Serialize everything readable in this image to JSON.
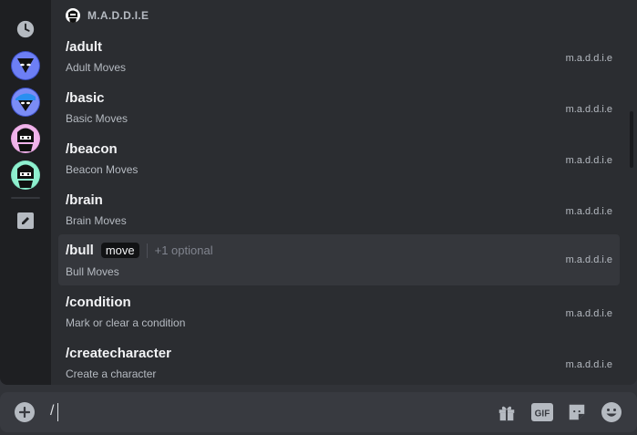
{
  "app_section": {
    "name": "M.A.D.D.I.E"
  },
  "rail": {
    "items": [
      {
        "id": "recent",
        "icon": "clock-icon"
      },
      {
        "id": "bot-1",
        "icon": "bot-avatar-blue"
      },
      {
        "id": "bot-2",
        "icon": "bot-avatar-cap"
      },
      {
        "id": "bot-3",
        "icon": "bot-avatar-pink"
      },
      {
        "id": "bot-4",
        "icon": "bot-avatar-green"
      },
      {
        "id": "edit",
        "icon": "pencil-icon"
      }
    ]
  },
  "commands": [
    {
      "name": "/adult",
      "description": "Adult Moves",
      "source": "m.a.d.d.i.e"
    },
    {
      "name": "/basic",
      "description": "Basic Moves",
      "source": "m.a.d.d.i.e"
    },
    {
      "name": "/beacon",
      "description": "Beacon Moves",
      "source": "m.a.d.d.i.e"
    },
    {
      "name": "/brain",
      "description": "Brain Moves",
      "source": "m.a.d.d.i.e"
    },
    {
      "name": "/bull",
      "description": "Bull Moves",
      "source": "m.a.d.d.i.e",
      "option": "move",
      "more": "+1 optional",
      "active": true
    },
    {
      "name": "/condition",
      "description": "Mark or clear a condition",
      "source": "m.a.d.d.i.e"
    },
    {
      "name": "/createcharacter",
      "description": "Create a character",
      "source": "m.a.d.d.i.e"
    }
  ],
  "composer": {
    "value": "/",
    "tools": [
      "gift-icon",
      "gif-icon",
      "sticker-icon",
      "emoji-icon"
    ],
    "gif_label": "GIF"
  },
  "colors": {
    "accent": "#5865f2",
    "bg": "#313338",
    "popup": "#2b2d31"
  }
}
